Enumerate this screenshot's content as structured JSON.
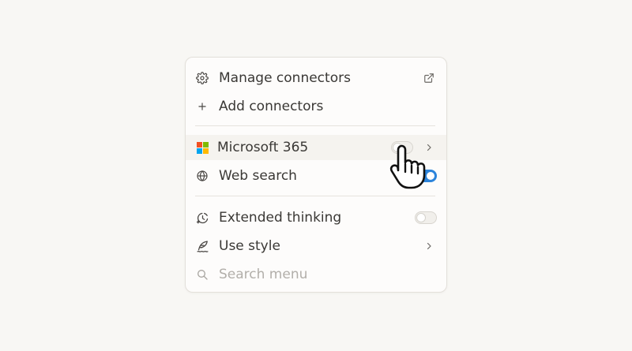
{
  "menu": {
    "manage_connectors": "Manage connectors",
    "add_connectors": "Add connectors",
    "microsoft_365": "Microsoft 365",
    "web_search": "Web search",
    "extended_thinking": "Extended thinking",
    "use_style": "Use style",
    "search_placeholder": "Search menu"
  },
  "icons": {
    "manage": "gear-icon",
    "add": "plus-icon",
    "external": "external-link-icon",
    "ms": "microsoft-logo-icon",
    "web": "globe-icon",
    "thinking": "clock-sparkle-icon",
    "style": "quill-icon",
    "chevron": "chevron-right-icon",
    "search": "search-icon",
    "cursor": "hand-pointer-icon"
  },
  "toggles": {
    "microsoft_365": "off",
    "web_search": "on",
    "extended_thinking": "off"
  },
  "colors": {
    "ms_red": "#f25022",
    "ms_green": "#7fba00",
    "ms_blue": "#00a4ef",
    "ms_yellow": "#ffb900",
    "toggle_on": "#2c84db"
  }
}
